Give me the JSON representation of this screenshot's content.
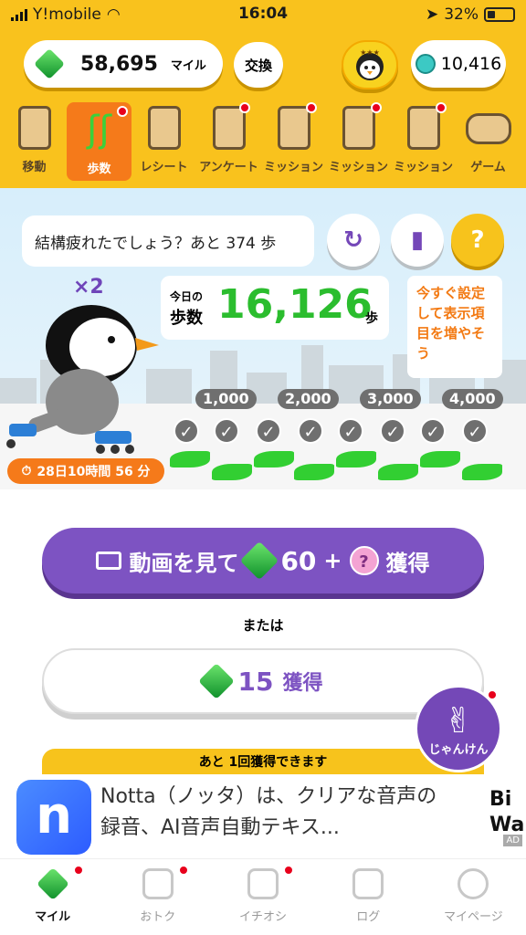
{
  "status": {
    "carrier": "Y!mobile",
    "time": "16:04",
    "battery": "32%"
  },
  "header": {
    "miles_value": "58,695",
    "miles_unit": "マイル",
    "exchange_label": "交換",
    "coins_value": "10,416"
  },
  "tabs": [
    {
      "label": "移動"
    },
    {
      "label": "歩数"
    },
    {
      "label": "レシート"
    },
    {
      "label": "アンケート"
    },
    {
      "label": "ミッション"
    },
    {
      "label": "ミッション"
    },
    {
      "label": "ミッション"
    },
    {
      "label": "ゲーム"
    }
  ],
  "scene": {
    "bubble_text": "結構疲れたでしょう？あと 374 歩",
    "multiplier": "×2",
    "today_label": "今日の",
    "steps_label": "歩数",
    "steps_value": "16,126",
    "steps_unit": "歩",
    "tip_text": "今すぐ設定して表示項目を増やそう",
    "milestones": [
      "1,000",
      "2,000",
      "3,000",
      "4,000"
    ],
    "timer": "28日10時間 56 分"
  },
  "actions": {
    "watch_prefix": "動画を見て",
    "watch_amount": "60",
    "watch_plus": "+",
    "watch_suffix": "獲得",
    "or_label": "または",
    "get_amount": "15",
    "get_suffix": "獲得",
    "janken_label": "じゃんけん",
    "remaining_text": "あと 1回獲得できます"
  },
  "ad": {
    "text": "Notta（ノッタ）は、クリアな音声の録音、AI音声自動テキス...",
    "side_text": "Bi Wa",
    "badge": "AD"
  },
  "nav": [
    {
      "label": "マイル"
    },
    {
      "label": "おトク"
    },
    {
      "label": "イチオシ"
    },
    {
      "label": "ログ"
    },
    {
      "label": "マイページ"
    }
  ]
}
